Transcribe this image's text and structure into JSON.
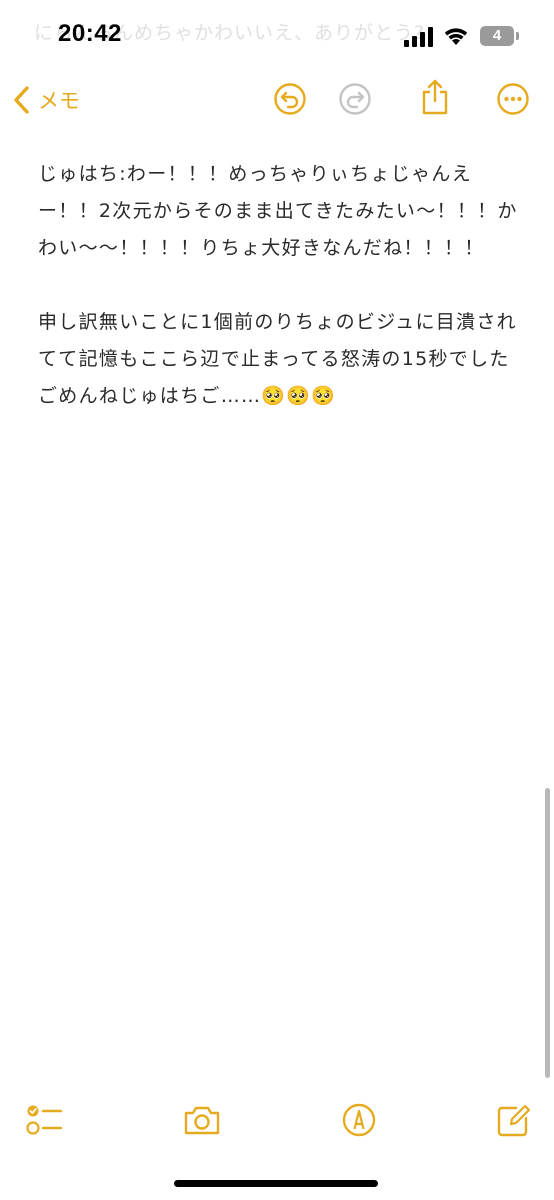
{
  "status_bar": {
    "time": "20:42",
    "battery_level": "4",
    "ghost_text": "にらんらんめちゃかわいいえ、ありがとう?"
  },
  "nav": {
    "back_label": "メモ",
    "icons": [
      "chevron-left-icon",
      "undo-icon",
      "redo-icon",
      "share-icon",
      "more-icon"
    ]
  },
  "note": {
    "paragraphs": [
      "じゅはち:わー！！！めっちゃりぃちょじゃんえー！！2次元からそのまま出てきたみたい〜！！！かわい〜〜！！！！りちょ大好きなんだね！！！！",
      "申し訳無いことに1個前のりちょのビジュに目潰されてて記憶もここら辺で止まってる怒涛の15秒でしたごめんねじゅはちご……🥺🥺🥺"
    ]
  },
  "toolbar": {
    "icons": [
      "checklist-icon",
      "camera-icon",
      "markup-icon",
      "compose-icon"
    ]
  },
  "colors": {
    "accent": "#e6aa1e",
    "disabled": "#c4c4c4",
    "text": "#2a2a2a"
  }
}
